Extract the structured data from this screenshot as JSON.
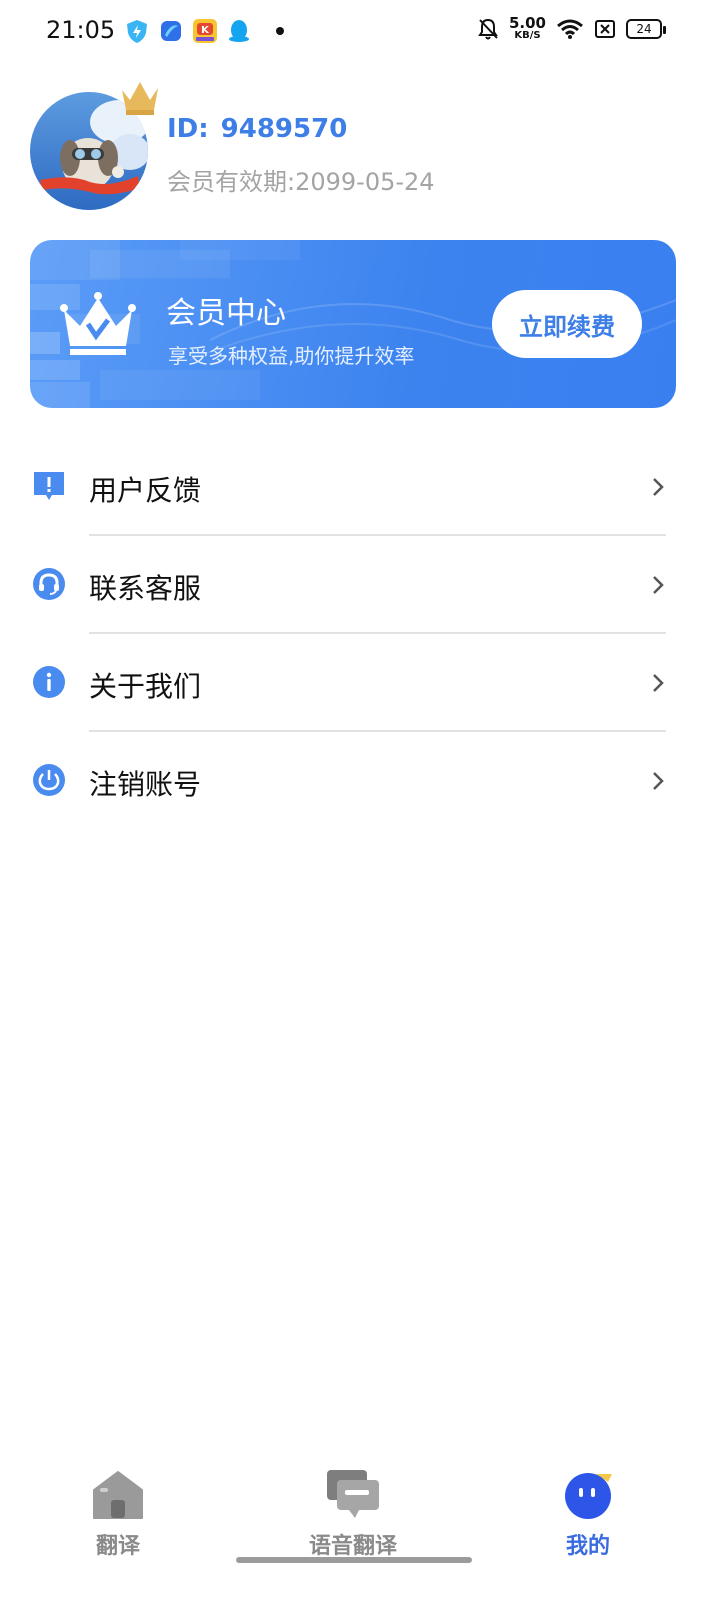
{
  "status_bar": {
    "time": "21:05",
    "net_speed_value": "5.00",
    "net_speed_unit": "KB/S",
    "battery": "24",
    "icons": [
      "shield-app-icon",
      "blue-app-icon",
      "game-app-icon",
      "qq-icon",
      "notification-dot",
      "bell-muted-icon",
      "wifi-icon",
      "sim-off-icon",
      "battery-icon"
    ]
  },
  "profile": {
    "id_label": "ID:",
    "id_value": "9489570",
    "expiry_text": "会员有效期:2099-05-24"
  },
  "member_card": {
    "title": "会员中心",
    "subtitle": "享受多种权益,助你提升效率",
    "button_label": "立即续费"
  },
  "menu": {
    "items": [
      {
        "label": "用户反馈",
        "icon": "feedback-icon"
      },
      {
        "label": "联系客服",
        "icon": "headset-icon"
      },
      {
        "label": "关于我们",
        "icon": "info-icon"
      },
      {
        "label": "注销账号",
        "icon": "power-icon"
      }
    ]
  },
  "bottom_nav": {
    "items": [
      {
        "label": "翻译",
        "icon": "home-icon",
        "active": false
      },
      {
        "label": "语音翻译",
        "icon": "chat-icon",
        "active": false
      },
      {
        "label": "我的",
        "icon": "profile-face-icon",
        "active": true
      }
    ]
  },
  "colors": {
    "accent": "#3d7fe6",
    "card_gradient_start": "#5a9cf7",
    "card_gradient_end": "#3a7ff0",
    "inactive_nav": "#8a8a8a",
    "secondary_text": "#a4a4a4"
  }
}
